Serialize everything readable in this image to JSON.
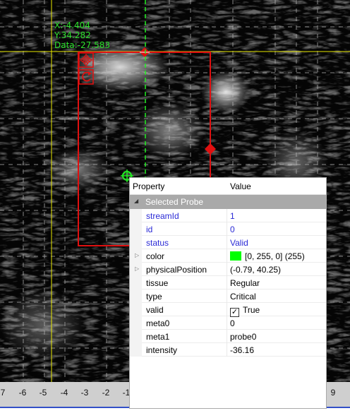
{
  "readout": {
    "x": "X:-4.404",
    "y": "Y:34.282",
    "data": "Data:-27.583"
  },
  "axis": {
    "tick_labels": [
      "7",
      "-6",
      "-5",
      "-4",
      "-3",
      "-2",
      "-1",
      "9"
    ]
  },
  "property_grid": {
    "col_property": "Property",
    "col_value": "Value",
    "category": "Selected Probe",
    "rows": [
      {
        "name": "streamId",
        "value": "1"
      },
      {
        "name": "id",
        "value": "0"
      },
      {
        "name": "status",
        "value": "Valid"
      },
      {
        "name": "color",
        "value": "[0, 255, 0] (255)"
      },
      {
        "name": "physicalPosition",
        "value": "(-0.79, 40.25)"
      },
      {
        "name": "tissue",
        "value": "Regular"
      },
      {
        "name": "type",
        "value": "Critical"
      },
      {
        "name": "valid",
        "value": "True"
      },
      {
        "name": "meta0",
        "value": "0"
      },
      {
        "name": "meta1",
        "value": "probe0"
      },
      {
        "name": "intensity",
        "value": "-36.16"
      }
    ]
  },
  "colors": {
    "roi": "#e01010",
    "crosshair": "#e8e800",
    "probe": "#22ee22",
    "probe_swatch": "#00ff00",
    "axis_line": "#3350c8"
  },
  "icons": {
    "move_handle": "move-icon",
    "rotate_handle": "rotate-icon",
    "probe_marker": "probe-crosshair-icon"
  }
}
